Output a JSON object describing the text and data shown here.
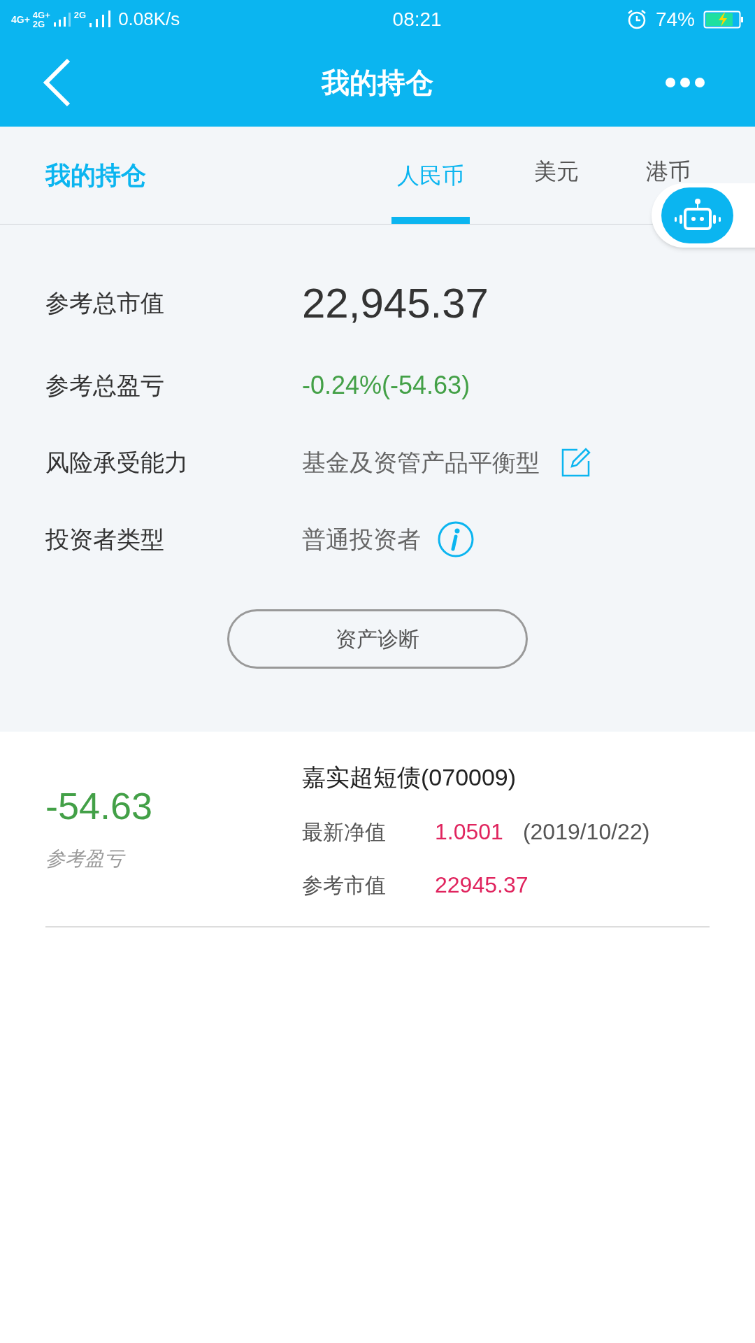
{
  "status_bar": {
    "network_1": "4G+",
    "network_2": "4G+",
    "network_3": "2G",
    "network_4": "2G",
    "speed": "0.08K/s",
    "time": "08:21",
    "battery": "74%",
    "charging": true
  },
  "header": {
    "title": "我的持仓"
  },
  "tab_bar": {
    "label": "我的持仓",
    "tabs": [
      {
        "label": "人民币",
        "selected": true
      },
      {
        "label": "美元",
        "selected": false
      },
      {
        "label": "港币",
        "selected": false
      }
    ]
  },
  "summary": [
    {
      "kind": "big",
      "label": "参考总市值",
      "value": "22,945.37"
    },
    {
      "kind": "gain",
      "label": "参考总盈亏",
      "value": "-0.24%(-54.63)"
    },
    {
      "kind": "edit",
      "label": "风险承受能力",
      "value": "基金及资管产品平衡型"
    },
    {
      "kind": "info",
      "label": "投资者类型",
      "value": "普通投资者"
    }
  ],
  "diagnose_button": "资产诊断",
  "holdings": [
    {
      "profit": "-54.63",
      "profit_label": "参考盈亏",
      "name": "嘉实超短债(070009)",
      "nav_label": "最新净值",
      "nav": "1.0501",
      "nav_date": "(2019/10/22)",
      "value_label": "参考市值",
      "value": "22945.37"
    }
  ]
}
